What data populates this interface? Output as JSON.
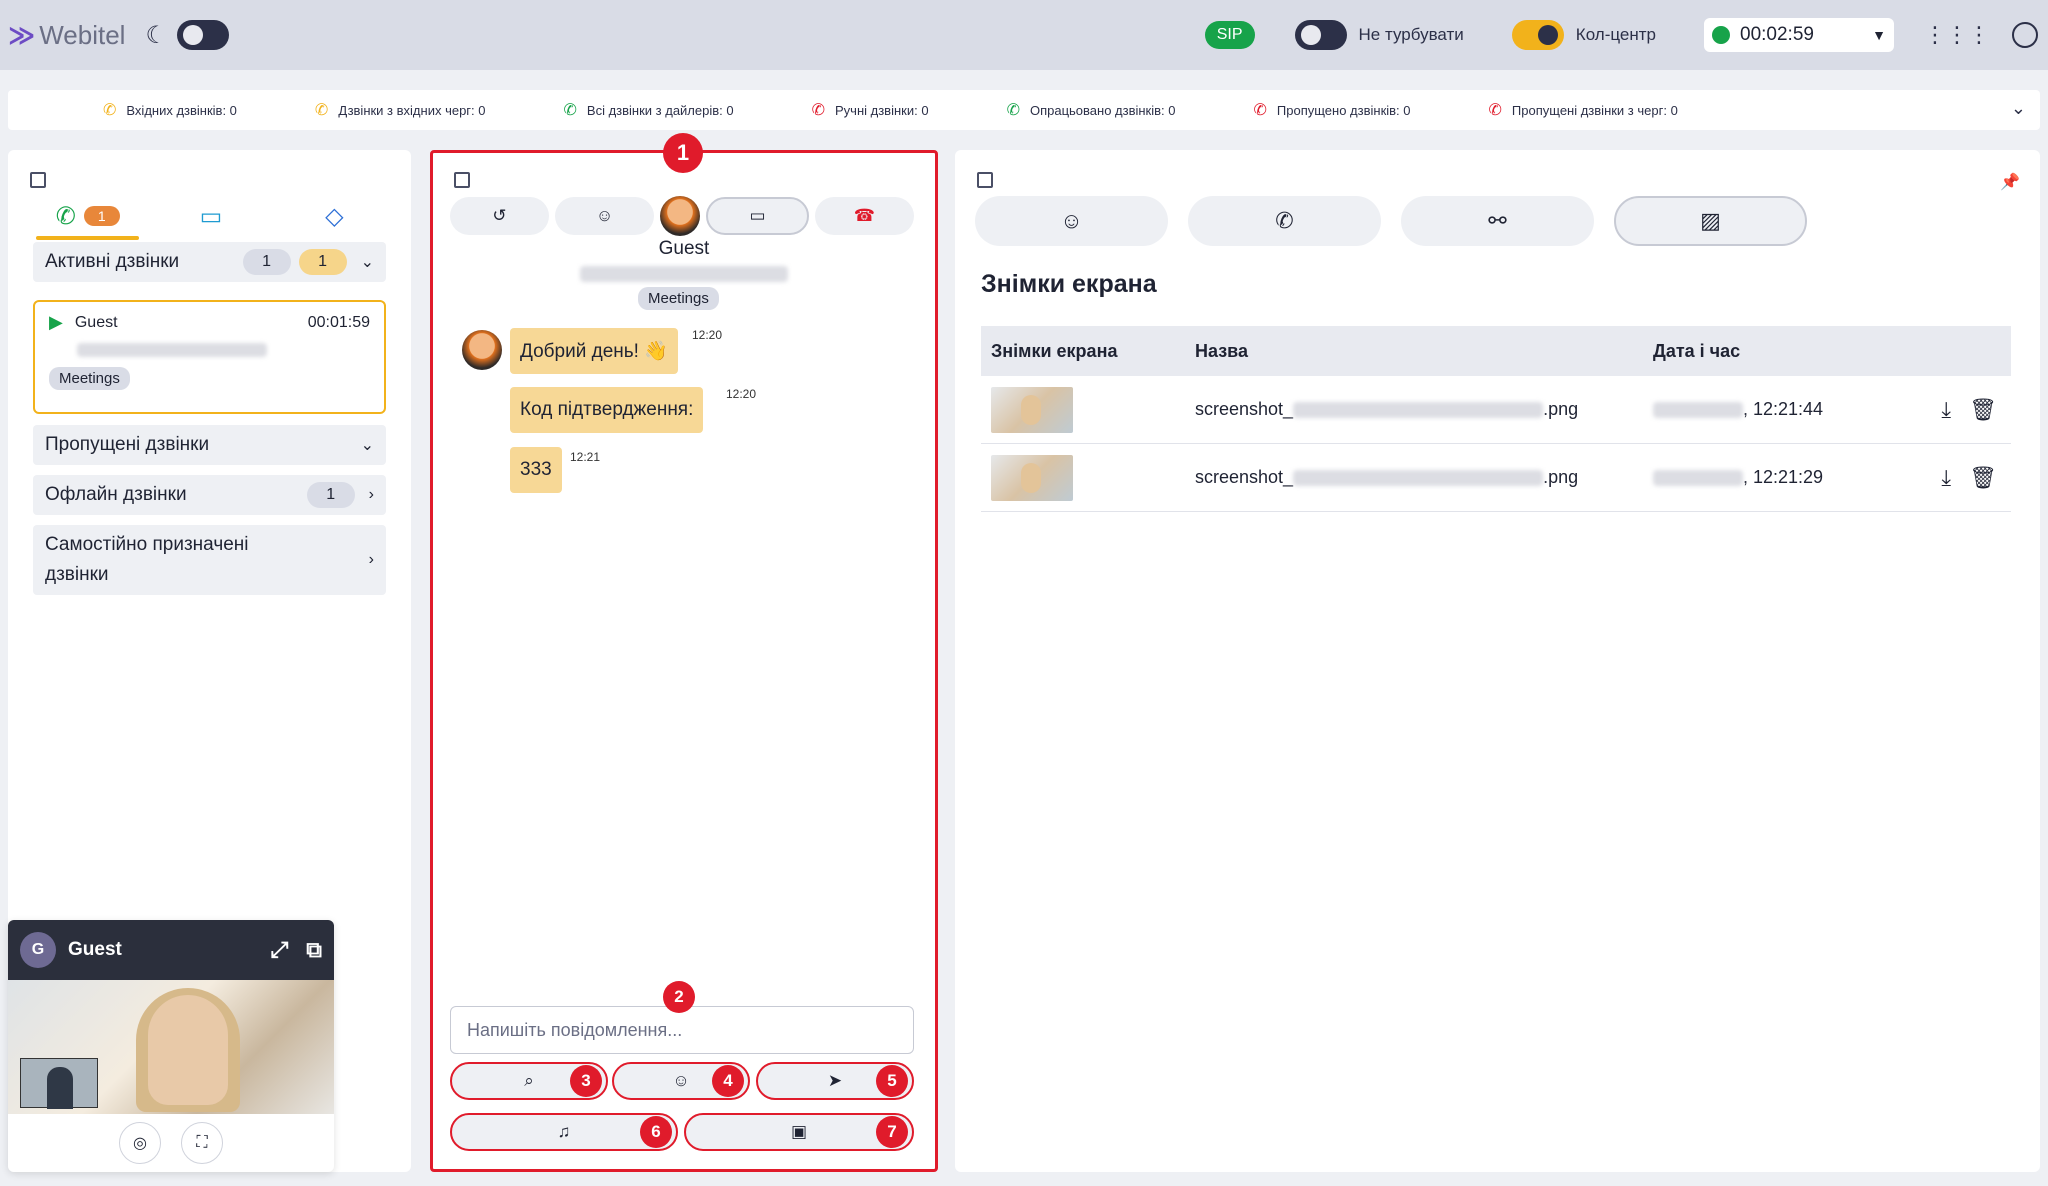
{
  "header": {
    "logo": "Webitel",
    "sip": "SIP",
    "dnd_label": "Не турбувати",
    "callcenter_label": "Кол-центр",
    "timer": "00:02:59"
  },
  "stats": [
    {
      "label": "Вхідних дзвінків: 0",
      "color": "#f2b21b"
    },
    {
      "label": "Дзвінки з вхідних черг: 0",
      "color": "#f2b21b"
    },
    {
      "label": "Всі дзвінки з дайлерів: 0",
      "color": "#17a34a"
    },
    {
      "label": "Ручні дзвінки: 0",
      "color": "#e01b2b"
    },
    {
      "label": "Опрацьовано дзвінків: 0",
      "color": "#17a34a"
    },
    {
      "label": "Пропущено дзвінків: 0",
      "color": "#e01b2b"
    },
    {
      "label": "Пропущені дзвінки з черг: 0",
      "color": "#e01b2b"
    }
  ],
  "left": {
    "calls_badge": "1",
    "active": {
      "label": "Активні дзвінки",
      "count1": "1",
      "count2": "1"
    },
    "card": {
      "name": "Guest",
      "time": "00:01:59",
      "tag": "Meetings"
    },
    "missed": {
      "label": "Пропущені дзвінки"
    },
    "offline": {
      "label": "Офлайн дзвінки",
      "count": "1"
    },
    "self": {
      "label_line1": "Самостійно призначені",
      "label_line2": "дзвінки"
    }
  },
  "video": {
    "initial": "G",
    "name": "Guest"
  },
  "center": {
    "guest": "Guest",
    "tag": "Meetings",
    "messages": [
      {
        "text": "Добрий день! 👋",
        "time": "12:20"
      },
      {
        "text": "Код підтвердження:",
        "time": "12:20"
      },
      {
        "text": "333",
        "time": "12:21"
      }
    ],
    "placeholder": "Напишіть повідомлення...",
    "markers": [
      "1",
      "2",
      "3",
      "4",
      "5",
      "6",
      "7"
    ]
  },
  "right": {
    "title": "Знімки екрана",
    "columns": [
      "Знімки екрана",
      "Назва",
      "Дата і час"
    ],
    "rows": [
      {
        "name_prefix": "screenshot_",
        "name_suffix": ".png",
        "time_suffix": ", 12:21:44"
      },
      {
        "name_prefix": "screenshot_",
        "name_suffix": ".png",
        "time_suffix": ", 12:21:29"
      }
    ]
  }
}
